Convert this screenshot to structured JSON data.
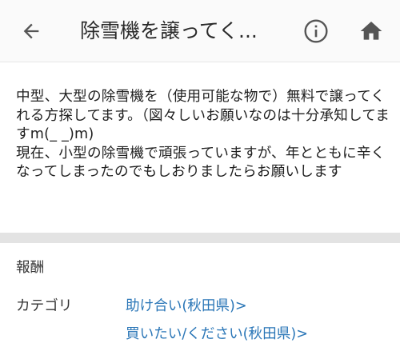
{
  "appbar": {
    "title": "除雪機を譲ってく...",
    "icons": {
      "back": "arrow-back-icon",
      "info": "info-icon",
      "home": "home-icon"
    },
    "icon_color": "#555555"
  },
  "post": {
    "description": "中型、大型の除雪機を（使用可能な物で）無料で譲ってくれる方探してます。（図々しいお願いなのは十分承知してますm(_ _)m)\n現在、小型の除雪機で頑張っていますが、年とともに辛くなってしまったのでもしおりましたらお願いします"
  },
  "details": {
    "reward_label": "報酬",
    "category_label": "カテゴリ",
    "categories": [
      {
        "label": "助け合い(秋田県)>"
      },
      {
        "label": "買いたい/ください(秋田県)>"
      }
    ],
    "link_color": "#2a76b7"
  }
}
